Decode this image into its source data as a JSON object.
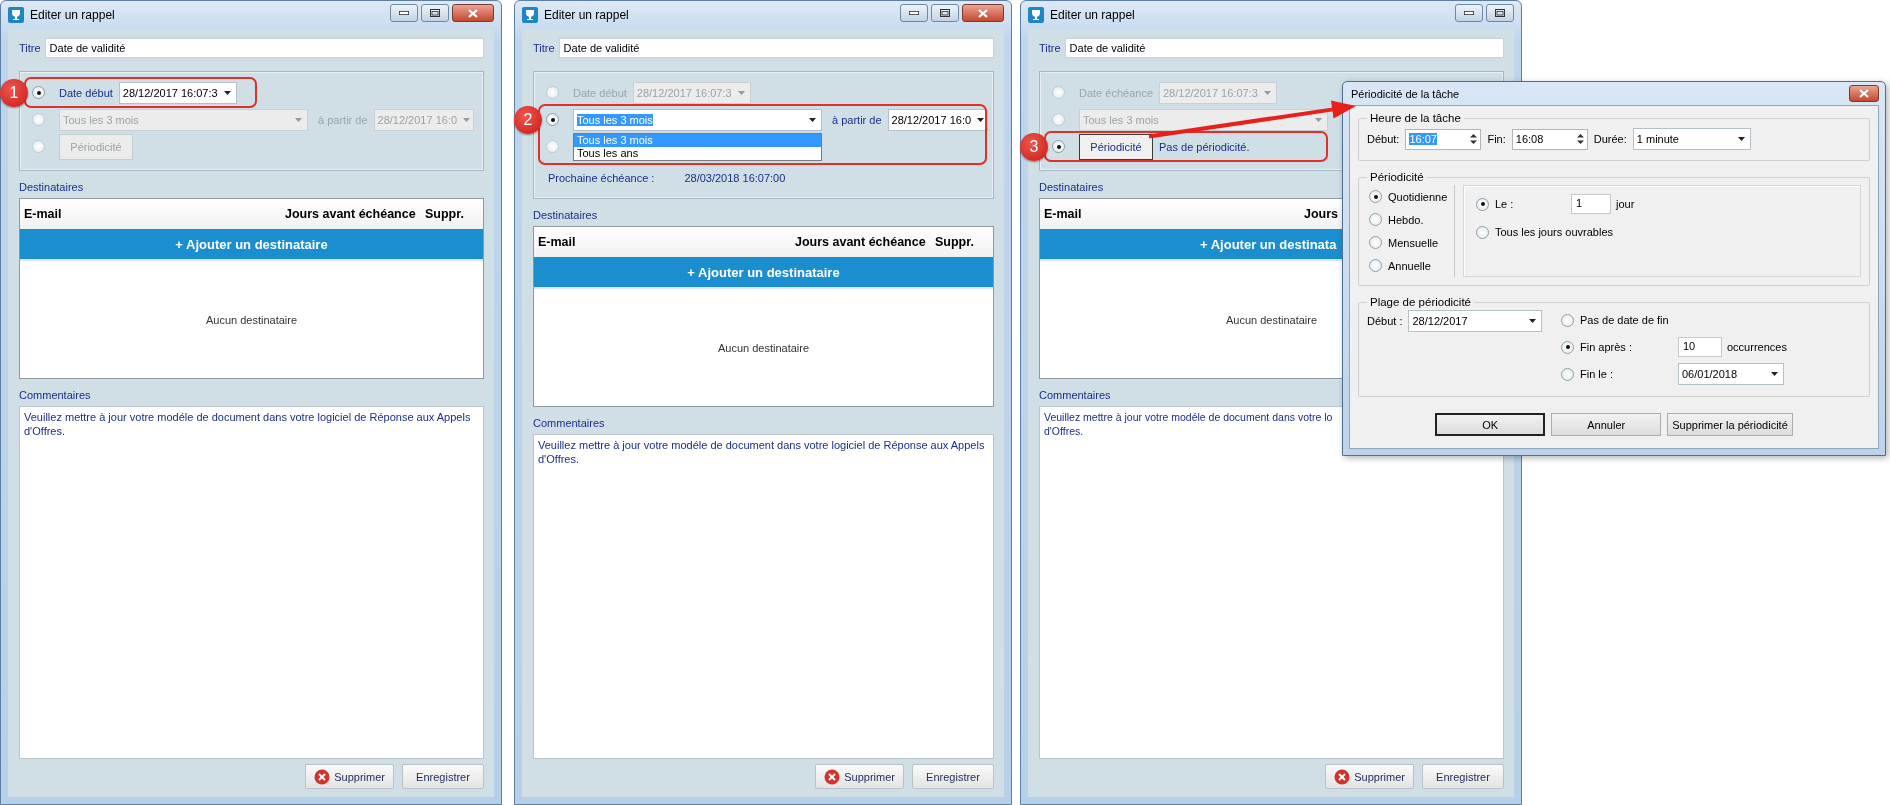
{
  "windows": [
    {
      "title": "Editer un rappel",
      "close_button": true,
      "overlapped": false,
      "title_field": {
        "label": "Titre",
        "value": "Date de validité"
      },
      "options": [
        {
          "kind": "date",
          "label": "Date début",
          "value": "28/12/2017 16:07:3",
          "selected": true,
          "disabled": false,
          "callout": "1"
        },
        {
          "kind": "combo",
          "value": "Tous les 3 mois",
          "text_selected": false,
          "from_label": "à partir de",
          "from_value": "28/12/2017 16:0",
          "selected": false,
          "disabled": true
        },
        {
          "kind": "button",
          "label": "Périodicité",
          "selected": false,
          "disabled": true
        }
      ],
      "recipients": {
        "label": "Destinataires",
        "columns": [
          "E-mail",
          "Jours avant échéance",
          "Suppr."
        ],
        "add_button": "+ Ajouter un destinataire",
        "empty_text": "Aucun destinataire"
      },
      "comments": {
        "label": "Commentaires",
        "lines": [
          "Veuillez mettre à jour votre modéle de document dans votre logiciel de Réponse aux Appels",
          "d'Offres."
        ]
      },
      "buttons": [
        {
          "kind": "delete",
          "label": "Supprimer"
        },
        {
          "kind": "save",
          "label": "Enregistrer"
        }
      ]
    },
    {
      "title": "Editer un rappel",
      "close_button": true,
      "overlapped": false,
      "title_field": {
        "label": "Titre",
        "value": "Date de validité"
      },
      "options": [
        {
          "kind": "date",
          "label": "Date début",
          "value": "28/12/2017 16:07:3",
          "selected": false,
          "disabled": true
        },
        {
          "kind": "combo",
          "value": "Tous les 3 mois",
          "text_selected": true,
          "from_label": "à partir de",
          "from_value": "28/12/2017 16:0",
          "selected": true,
          "disabled": false,
          "callout": "2",
          "open_list": [
            {
              "label": "Tous les 3 mois",
              "selected": true
            },
            {
              "label": "Tous les ans",
              "selected": false
            }
          ]
        },
        {
          "kind": "button",
          "selected": false,
          "disabled": true
        }
      ],
      "next_due": {
        "label": "Prochaine échéance :",
        "value": "28/03/2018 16:07:00"
      },
      "recipients": {
        "label": "Destinataires",
        "columns": [
          "E-mail",
          "Jours avant échéance",
          "Suppr."
        ],
        "add_button": "+ Ajouter un destinataire",
        "empty_text": "Aucun destinataire"
      },
      "comments": {
        "label": "Commentaires",
        "lines": [
          "Veuillez mettre à jour votre modéle de document dans votre logiciel de Réponse aux Appels",
          "d'Offres."
        ]
      },
      "buttons": [
        {
          "kind": "delete",
          "label": "Supprimer"
        },
        {
          "kind": "save",
          "label": "Enregistrer"
        }
      ]
    },
    {
      "title": "Editer un rappel",
      "close_button": false,
      "overlapped": true,
      "title_field": {
        "label": "Titre",
        "value": "Date de validité"
      },
      "options": [
        {
          "kind": "date",
          "label": "Date échéance",
          "value": "28/12/2017 16:07:3",
          "selected": false,
          "disabled": true
        },
        {
          "kind": "combo",
          "value": "Tous les 3 mois",
          "text_selected": false,
          "selected": false,
          "disabled": true
        },
        {
          "kind": "button",
          "label": "Périodicité",
          "note": "Pas de périodicité.",
          "selected": true,
          "disabled": false,
          "callout": "3"
        }
      ],
      "recipients": {
        "label": "Destinataires",
        "columns": [
          "E-mail",
          "Jours"
        ],
        "add_button": "+ Ajouter un destinata",
        "empty_text": "Aucun destinataire"
      },
      "comments": {
        "label": "Commentaires",
        "lines": [
          "Veuillez mettre à jour votre modéle de document dans votre lo",
          "d'Offres."
        ]
      },
      "buttons": [
        {
          "kind": "delete",
          "label": "Supprimer"
        },
        {
          "kind": "save",
          "label": "Enregistrer"
        }
      ]
    }
  ],
  "callout_arrow": true,
  "dialog": {
    "title": "Périodicité de la tâche",
    "time": {
      "legend": "Heure de la tâche",
      "start_label": "Début:",
      "start_value": "16:07",
      "start_highlighted": true,
      "end_label": "Fin:",
      "end_value": "16:08",
      "duration_label": "Durée:",
      "duration_value": "1 minute"
    },
    "recurrence": {
      "legend": "Périodicité",
      "patterns": [
        {
          "label": "Quotidienne",
          "selected": true
        },
        {
          "label": "Hebdo.",
          "selected": false
        },
        {
          "label": "Mensuelle",
          "selected": false
        },
        {
          "label": "Annuelle",
          "selected": false
        }
      ],
      "options": [
        {
          "kind": "every",
          "label": "Le :",
          "value": "1",
          "unit": "jour",
          "selected": true
        },
        {
          "kind": "plain",
          "label": "Tous les jours ouvrables",
          "selected": false
        }
      ]
    },
    "range": {
      "legend": "Plage de périodicité",
      "start_label": "Début :",
      "start_value": "28/12/2017",
      "end_options": [
        {
          "kind": "plain",
          "label": "Pas de date de fin",
          "selected": false
        },
        {
          "kind": "count",
          "label": "Fin après :",
          "value": "10",
          "unit": "occurrences",
          "selected": true
        },
        {
          "kind": "date",
          "label": "Fin le :",
          "value": "06/01/2018",
          "selected": false
        }
      ]
    },
    "buttons": [
      {
        "label": "OK",
        "default": true
      },
      {
        "label": "Annuler",
        "default": false
      },
      {
        "label": "Supprimer la périodicité",
        "default": false
      }
    ]
  }
}
